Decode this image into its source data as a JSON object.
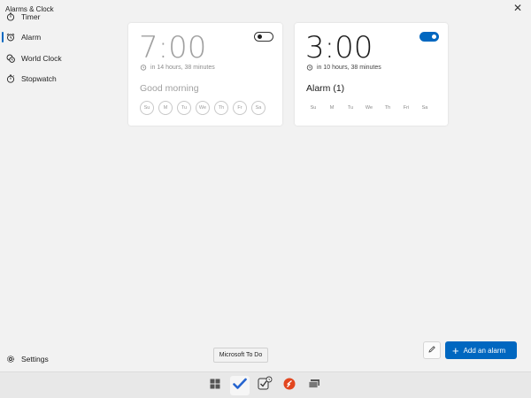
{
  "window": {
    "title": "Alarms & Clock"
  },
  "sidebar": {
    "items": [
      {
        "label": "Timer",
        "icon": "timer-icon"
      },
      {
        "label": "Alarm",
        "icon": "alarm-icon",
        "active": true
      },
      {
        "label": "World Clock",
        "icon": "world-clock-icon"
      },
      {
        "label": "Stopwatch",
        "icon": "stopwatch-icon"
      }
    ],
    "settings_label": "Settings"
  },
  "alarms": [
    {
      "time": "7:00",
      "remaining": "in 14 hours, 38 minutes",
      "name": "Good morning",
      "enabled": false,
      "days": [
        "Su",
        "M",
        "Tu",
        "We",
        "Th",
        "Fr",
        "Sa"
      ]
    },
    {
      "time": "3:00",
      "remaining": "in 10 hours, 38 minutes",
      "name": "Alarm (1)",
      "enabled": true,
      "days": [
        "Su",
        "M",
        "Tu",
        "We",
        "Th",
        "Fri",
        "Sa"
      ]
    }
  ],
  "actions": {
    "add_label": "Add an alarm"
  },
  "tooltip": {
    "text": "Microsoft To Do"
  },
  "taskbar": {
    "items": [
      {
        "icon": "windows-start-icon"
      },
      {
        "icon": "microsoft-todo-icon",
        "active": true
      },
      {
        "icon": "alarms-clock-icon"
      },
      {
        "icon": "app-icon"
      },
      {
        "icon": "task-view-icon"
      }
    ]
  },
  "colors": {
    "accent": "#0067c0",
    "background": "#f2f2f2",
    "card": "#ffffff"
  }
}
